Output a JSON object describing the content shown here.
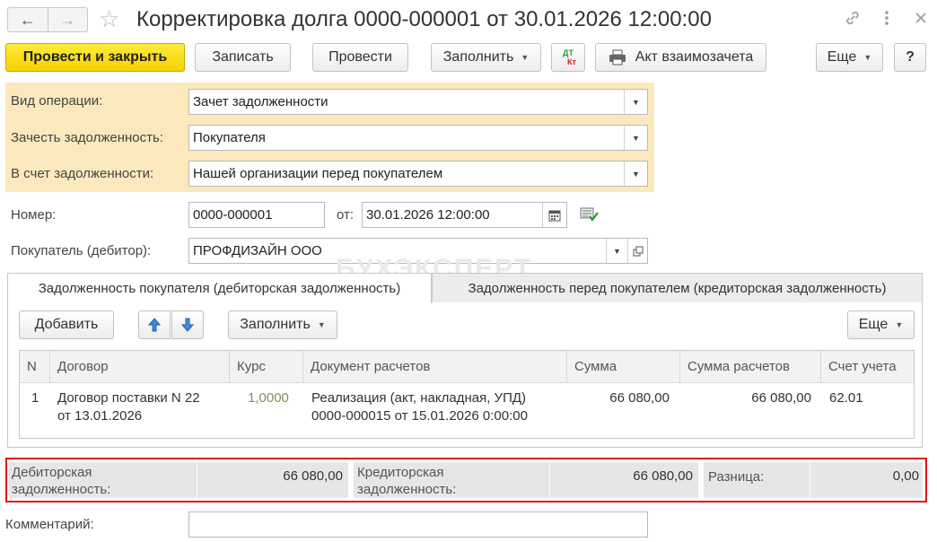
{
  "window": {
    "title": "Корректировка долга 0000-000001 от 30.01.2026 12:00:00",
    "back_icon": "arrow-left-icon",
    "forward_icon": "arrow-right-icon",
    "favorite_icon": "star-icon",
    "link_icon": "link-icon",
    "more_icon": "vertical-dots-icon",
    "close_icon": "close-icon"
  },
  "toolbar": {
    "post_close_label": "Провести и закрыть",
    "save_label": "Записать",
    "post_label": "Провести",
    "fill_label": "Заполнить",
    "dtkt_dt": "ДТ",
    "dtkt_kt": "Кт",
    "act_label": "Акт взаимозачета",
    "more_label": "Еще",
    "help_label": "?"
  },
  "form": {
    "operation_label": "Вид операции:",
    "operation_value": "Зачет задолженности",
    "offset_label": "Зачесть задолженность:",
    "offset_value": "Покупателя",
    "against_label": "В счет задолженности:",
    "against_value": "Нашей организации перед покупателем",
    "number_label": "Номер:",
    "number_value": "0000-000001",
    "date_label": "от:",
    "date_value": "30.01.2026 12:00:00",
    "buyer_label": "Покупатель (дебитор):",
    "buyer_value": "ПРОФДИЗАЙН ООО"
  },
  "watermark": "БУХЭКСПЕРТ",
  "tabs": [
    {
      "label": "Задолженность покупателя (дебиторская задолженность)",
      "active": true
    },
    {
      "label": "Задолженность перед покупателем (кредиторская задолженность)",
      "active": false
    }
  ],
  "table_toolbar": {
    "add_label": "Добавить",
    "fill_label": "Заполнить",
    "more_label": "Еще"
  },
  "table": {
    "columns": [
      "N",
      "Договор",
      "Курс",
      "Документ расчетов",
      "Сумма",
      "Сумма расчетов",
      "Счет учета"
    ],
    "rows": [
      {
        "n": "1",
        "contract_line1": "Договор поставки N 22",
        "contract_line2": "от 13.01.2026",
        "rate": "1,0000",
        "doc_line1": "Реализация (акт, накладная, УПД)",
        "doc_line2": "0000-000015 от 15.01.2026 0:00:00",
        "sum": "66 080,00",
        "calc_sum": "66 080,00",
        "account": "62.01"
      }
    ]
  },
  "totals": {
    "receivable_label_line1": "Дебиторская",
    "receivable_label_line2": "задолженность:",
    "receivable_value": "66 080,00",
    "payable_label_line1": "Кредиторская",
    "payable_label_line2": "задолженность:",
    "payable_value": "66 080,00",
    "diff_label": "Разница:",
    "diff_value": "0,00",
    "highlight_color": "#e1131b"
  },
  "comment": {
    "label": "Комментарий:",
    "value": ""
  }
}
